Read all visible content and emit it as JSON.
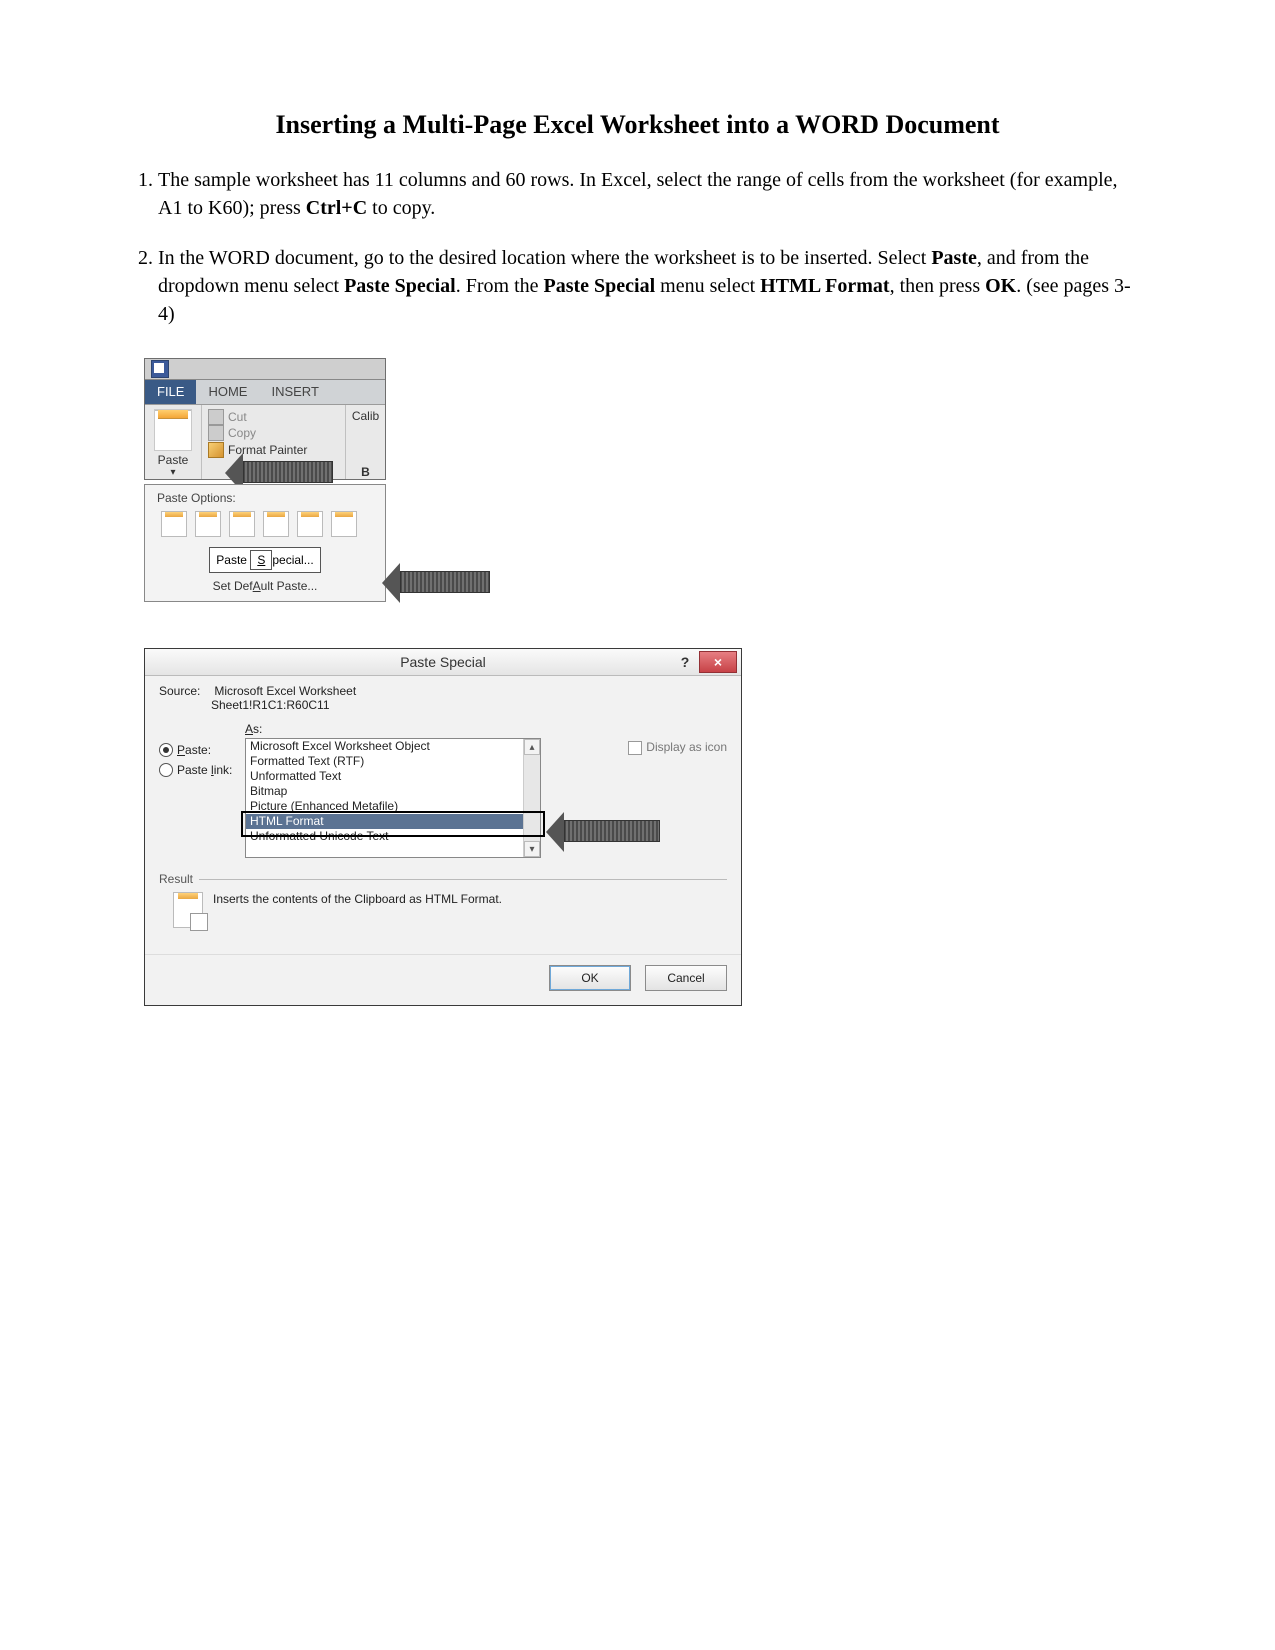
{
  "title": "Inserting a Multi-Page Excel Worksheet into a WORD Document",
  "steps": {
    "one_a": "The sample worksheet has 11 columns and 60 rows. In Excel, select the range of cells from the worksheet (for example, A1 to K60); press ",
    "one_b": "Ctrl+C",
    "one_c": " to copy.",
    "two_a": "In the WORD document, go to the desired location where the worksheet is to be inserted. Select ",
    "two_b": "Paste",
    "two_c": ", and from the dropdown menu select ",
    "two_d": "Paste Special",
    "two_e": ". From the ",
    "two_f": "Paste Special",
    "two_g": " menu select ",
    "two_h": "HTML Format",
    "two_i": ", then press ",
    "two_j": "OK",
    "two_k": ". (see pages 3-4)"
  },
  "ribbon": {
    "tabs": {
      "file": "FILE",
      "home": "HOME",
      "insert": "INSERT"
    },
    "paste_label": "Paste",
    "cut_label": "Cut",
    "copy_label": "Copy",
    "fmt_painter": "Format Painter",
    "font_name": "Calib",
    "bold_char": "B",
    "options_head": "Paste Options:",
    "paste_special": "Paste Special...",
    "paste_special_u": "S",
    "set_default": "Set Default Paste...",
    "set_default_u": "A"
  },
  "dialog": {
    "title": "Paste Special",
    "source_label": "Source:",
    "source_value": "Microsoft Excel Worksheet",
    "source_sheet": "Sheet1!R1C1:R60C11",
    "as_label": "As:",
    "radio_paste": "Paste:",
    "radio_paste_link": "Paste link:",
    "display_as_icon": "Display as icon",
    "options": [
      "Microsoft Excel Worksheet Object",
      "Formatted Text (RTF)",
      "Unformatted Text",
      "Bitmap",
      "Picture (Enhanced Metafile)",
      "HTML Format",
      "Unformatted Unicode Text"
    ],
    "result_label": "Result",
    "result_text": "Inserts the contents of the Clipboard as HTML Format.",
    "ok": "OK",
    "cancel": "Cancel",
    "u_paste": "P",
    "u_link": "l",
    "u_as": "A"
  }
}
